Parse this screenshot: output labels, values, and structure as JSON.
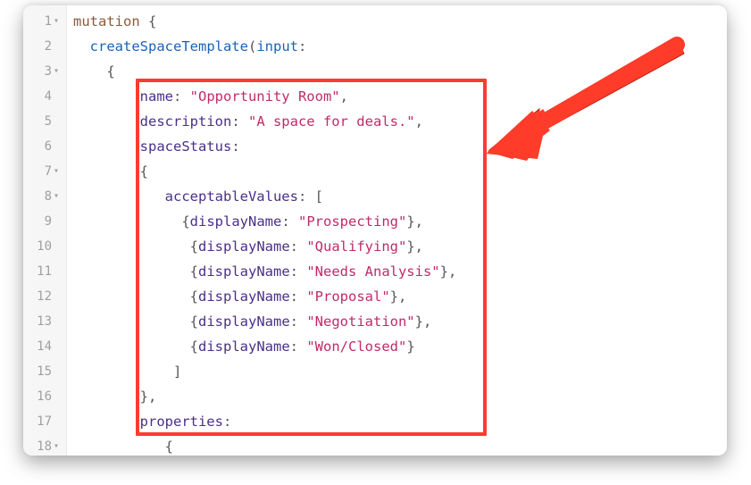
{
  "editor": {
    "fold_marker": "▾",
    "lines": [
      {
        "n": "1",
        "fold": true,
        "indent": 0,
        "tokens": [
          {
            "t": "mutation",
            "c": "kw"
          },
          {
            "t": " {",
            "c": "pun"
          }
        ]
      },
      {
        "n": "2",
        "fold": false,
        "indent": 2,
        "tokens": [
          {
            "t": "createSpaceTemplate",
            "c": "fn"
          },
          {
            "t": "(",
            "c": "pun"
          },
          {
            "t": "input",
            "c": "fn"
          },
          {
            "t": ":",
            "c": "pun"
          }
        ]
      },
      {
        "n": "3",
        "fold": true,
        "indent": 4,
        "tokens": [
          {
            "t": "{",
            "c": "pun"
          }
        ]
      },
      {
        "n": "4",
        "fold": false,
        "indent": 8,
        "tokens": [
          {
            "t": "name",
            "c": "attr"
          },
          {
            "t": ": ",
            "c": "pun"
          },
          {
            "t": "\"Opportunity Room\"",
            "c": "str"
          },
          {
            "t": ",",
            "c": "pun"
          }
        ]
      },
      {
        "n": "5",
        "fold": false,
        "indent": 8,
        "tokens": [
          {
            "t": "description",
            "c": "attr"
          },
          {
            "t": ": ",
            "c": "pun"
          },
          {
            "t": "\"A space for deals.\"",
            "c": "str"
          },
          {
            "t": ",",
            "c": "pun"
          }
        ]
      },
      {
        "n": "6",
        "fold": false,
        "indent": 8,
        "tokens": [
          {
            "t": "spaceStatus",
            "c": "attr"
          },
          {
            "t": ":",
            "c": "pun"
          }
        ]
      },
      {
        "n": "7",
        "fold": true,
        "indent": 8,
        "tokens": [
          {
            "t": "{",
            "c": "pun"
          }
        ]
      },
      {
        "n": "8",
        "fold": true,
        "indent": 11,
        "tokens": [
          {
            "t": "acceptableValues",
            "c": "attr"
          },
          {
            "t": ": [",
            "c": "pun"
          }
        ]
      },
      {
        "n": "9",
        "fold": false,
        "indent": 13,
        "tokens": [
          {
            "t": "{",
            "c": "pun"
          },
          {
            "t": "displayName",
            "c": "attr"
          },
          {
            "t": ": ",
            "c": "pun"
          },
          {
            "t": "\"Prospecting\"",
            "c": "str"
          },
          {
            "t": "},",
            "c": "pun"
          }
        ]
      },
      {
        "n": "10",
        "fold": false,
        "indent": 14,
        "tokens": [
          {
            "t": "{",
            "c": "pun"
          },
          {
            "t": "displayName",
            "c": "attr"
          },
          {
            "t": ": ",
            "c": "pun"
          },
          {
            "t": "\"Qualifying\"",
            "c": "str"
          },
          {
            "t": "},",
            "c": "pun"
          }
        ]
      },
      {
        "n": "11",
        "fold": false,
        "indent": 14,
        "tokens": [
          {
            "t": "{",
            "c": "pun"
          },
          {
            "t": "displayName",
            "c": "attr"
          },
          {
            "t": ": ",
            "c": "pun"
          },
          {
            "t": "\"Needs Analysis\"",
            "c": "str"
          },
          {
            "t": "},",
            "c": "pun"
          }
        ]
      },
      {
        "n": "12",
        "fold": false,
        "indent": 14,
        "tokens": [
          {
            "t": "{",
            "c": "pun"
          },
          {
            "t": "displayName",
            "c": "attr"
          },
          {
            "t": ": ",
            "c": "pun"
          },
          {
            "t": "\"Proposal\"",
            "c": "str"
          },
          {
            "t": "},",
            "c": "pun"
          }
        ]
      },
      {
        "n": "13",
        "fold": false,
        "indent": 14,
        "tokens": [
          {
            "t": "{",
            "c": "pun"
          },
          {
            "t": "displayName",
            "c": "attr"
          },
          {
            "t": ": ",
            "c": "pun"
          },
          {
            "t": "\"Negotiation\"",
            "c": "str"
          },
          {
            "t": "},",
            "c": "pun"
          }
        ]
      },
      {
        "n": "14",
        "fold": false,
        "indent": 14,
        "tokens": [
          {
            "t": "{",
            "c": "pun"
          },
          {
            "t": "displayName",
            "c": "attr"
          },
          {
            "t": ": ",
            "c": "pun"
          },
          {
            "t": "\"Won/Closed\"",
            "c": "str"
          },
          {
            "t": "}",
            "c": "pun"
          }
        ]
      },
      {
        "n": "15",
        "fold": false,
        "indent": 12,
        "tokens": [
          {
            "t": "]",
            "c": "pun"
          }
        ]
      },
      {
        "n": "16",
        "fold": false,
        "indent": 8,
        "tokens": [
          {
            "t": "},",
            "c": "pun"
          }
        ]
      },
      {
        "n": "17",
        "fold": false,
        "indent": 8,
        "tokens": [
          {
            "t": "properties",
            "c": "attr"
          },
          {
            "t": ":",
            "c": "pun"
          }
        ]
      },
      {
        "n": "18",
        "fold": true,
        "indent": 11,
        "tokens": [
          {
            "t": "{",
            "c": "pun"
          }
        ]
      }
    ]
  },
  "annotations": {
    "highlight_color": "#ff3b30",
    "arrow_color": "#ff3b30"
  }
}
